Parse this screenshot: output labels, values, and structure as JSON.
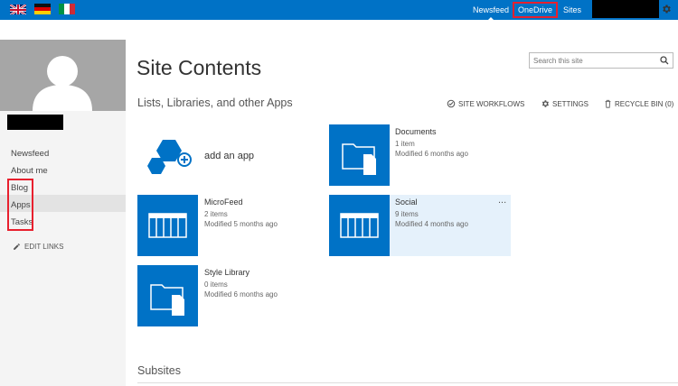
{
  "topbar": {
    "flags": [
      {
        "name": "uk-flag"
      },
      {
        "name": "germany-flag"
      },
      {
        "name": "italy-flag"
      }
    ],
    "nav": {
      "newsfeed": "Newsfeed",
      "onedrive": "OneDrive",
      "sites": "Sites"
    },
    "colors": {
      "suite_bar": "#0072c6",
      "highlight": "#e8202e"
    }
  },
  "quicklaunch": {
    "items": [
      "Newsfeed",
      "About me",
      "Blog",
      "Apps",
      "Tasks"
    ],
    "edit_links": "EDIT LINKS"
  },
  "main": {
    "title": "Site Contents",
    "search_placeholder": "Search this site",
    "section_title": "Lists, Libraries, and other Apps",
    "toolbar": {
      "site_workflows": "SITE WORKFLOWS",
      "settings": "SETTINGS",
      "recycle_bin": "RECYCLE BIN (0)"
    },
    "add_app": "add an app",
    "apps": [
      {
        "title": "Documents",
        "items": "1 item",
        "modified": "Modified 6 months ago",
        "icon": "document-library-icon"
      },
      {
        "title": "MicroFeed",
        "items": "2 items",
        "modified": "Modified 5 months ago",
        "icon": "list-icon"
      },
      {
        "title": "Social",
        "items": "9 items",
        "modified": "Modified 4 months ago",
        "icon": "list-icon"
      },
      {
        "title": "Style Library",
        "items": "0 items",
        "modified": "Modified 6 months ago",
        "icon": "document-library-icon"
      }
    ],
    "app_menu": "...",
    "subsites_title": "Subsites"
  }
}
